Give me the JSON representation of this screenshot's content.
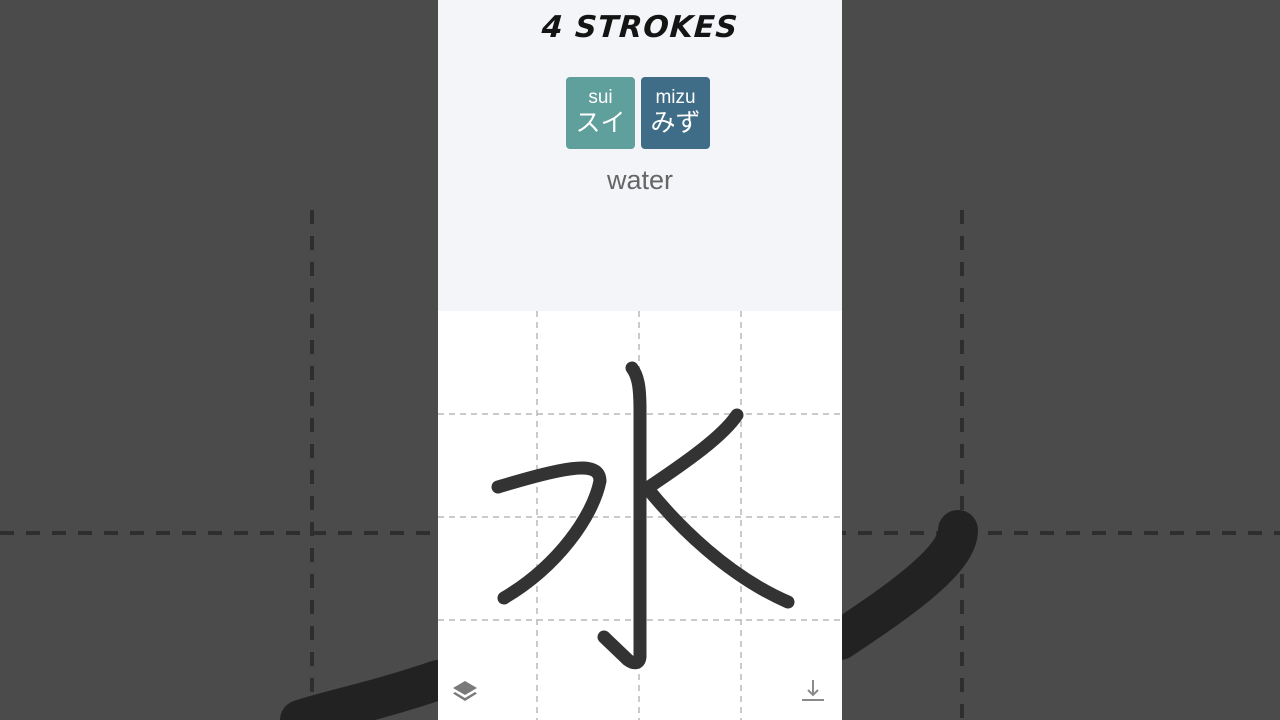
{
  "header": {
    "stroke_count_label": "4 STROKES"
  },
  "readings": {
    "on": {
      "romaji": "sui",
      "kana": "スイ"
    },
    "kun": {
      "romaji": "mizu",
      "kana": "みず"
    }
  },
  "meaning": "water",
  "kanji": {
    "character": "水"
  },
  "toolbar": {
    "layers_icon": "layers-icon",
    "download_icon": "download-icon"
  },
  "colors": {
    "on_reading_bg": "#5f9f9c",
    "kun_reading_bg": "#3f6c86",
    "stroke": "#333333",
    "background": "#4b4b4b"
  }
}
